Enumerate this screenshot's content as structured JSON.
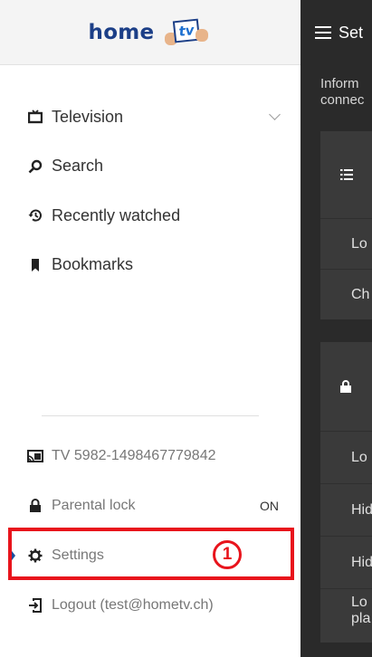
{
  "logo": {
    "text": "home",
    "tv_text": "tv"
  },
  "nav": {
    "items": [
      {
        "label": "Television",
        "icon": "tv-icon",
        "has_chevron": true
      },
      {
        "label": "Search",
        "icon": "search-icon"
      },
      {
        "label": "Recently watched",
        "icon": "history-icon"
      },
      {
        "label": "Bookmarks",
        "icon": "bookmark-icon"
      }
    ]
  },
  "bottom": {
    "items": [
      {
        "label": "TV 5982-1498467779842",
        "icon": "cast-icon"
      },
      {
        "label": "Parental lock",
        "icon": "lock-icon",
        "trail": "ON"
      },
      {
        "label": "Settings",
        "icon": "gear-icon",
        "selected": true
      },
      {
        "label": "Logout (test@hometv.ch)",
        "icon": "logout-icon"
      }
    ]
  },
  "annotation": {
    "step": "1",
    "color": "#e8141c"
  },
  "main": {
    "title": "Set",
    "info_line1": "Inform",
    "info_line2": "connec",
    "card1": {
      "rows": [
        "Lo",
        "Ch"
      ]
    },
    "card2": {
      "rows": [
        "Lo",
        "Hid",
        "Hid"
      ],
      "last_line1": "Lo",
      "last_line2": "pla"
    }
  },
  "colors": {
    "brand": "#1c3f87",
    "selected_marker": "#1a4d9c",
    "dark_bg": "#2a2a2a",
    "card_bg": "#3a3a3a"
  }
}
